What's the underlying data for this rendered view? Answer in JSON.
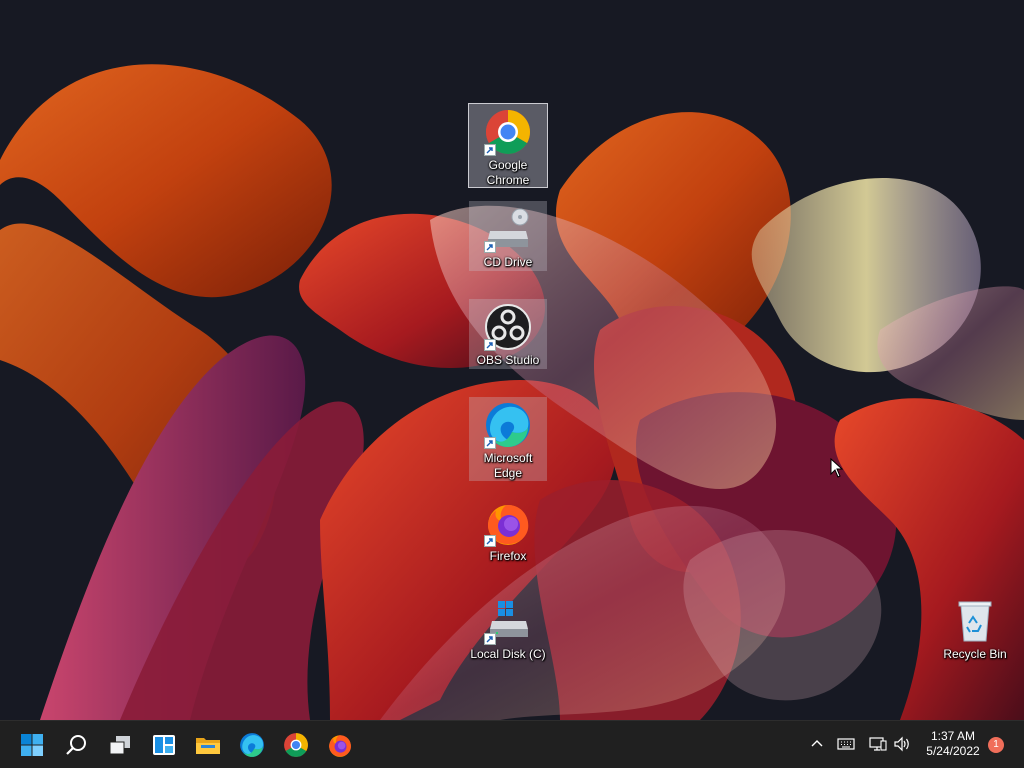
{
  "desktop": {
    "icons": [
      {
        "label": "Google Chrome",
        "icon": "chrome-icon"
      },
      {
        "label": "CD Drive",
        "icon": "cd-drive-icon"
      },
      {
        "label": "OBS Studio",
        "icon": "obs-studio-icon"
      },
      {
        "label": "Microsoft Edge",
        "icon": "edge-icon"
      },
      {
        "label": "Firefox",
        "icon": "firefox-icon"
      },
      {
        "label": "Local Disk (C)",
        "icon": "local-disk-icon"
      },
      {
        "label": "Recycle Bin",
        "icon": "recycle-bin-icon"
      }
    ]
  },
  "taskbar": {
    "pinned": [
      "start-icon",
      "search-icon",
      "task-view-icon",
      "widgets-icon",
      "file-explorer-icon",
      "edge-icon",
      "chrome-icon",
      "firefox-icon"
    ],
    "tray": [
      "chevron-up-icon",
      "keyboard-icon",
      "network-icon",
      "volume-icon"
    ],
    "clock": {
      "time": "1:37 AM",
      "date": "5/24/2022"
    },
    "notification_count": "1"
  },
  "colors": {
    "taskbar_bg": "#202020",
    "wallpaper_bg": "#171923",
    "start_blue": "#0a84d6",
    "notification_badge": "#f06e5a"
  }
}
